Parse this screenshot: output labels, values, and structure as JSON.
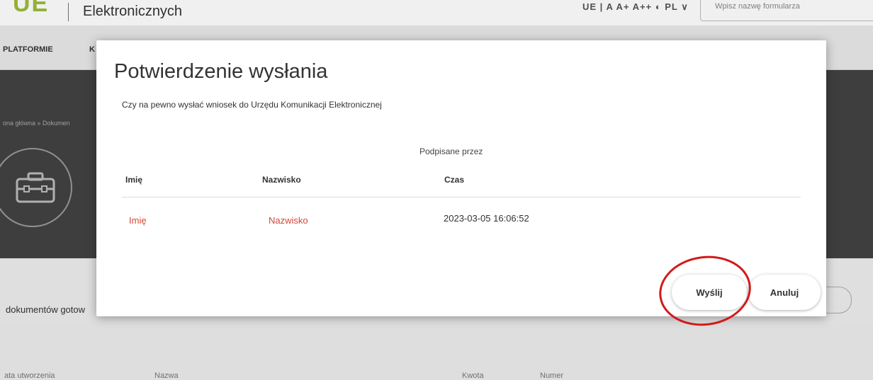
{
  "app": {
    "logo_mark": "UE",
    "logo_text": "Elektronicznych",
    "accessibility_tools": "UE | A A+ A++ ◐ PL ∨",
    "search_placeholder": "Wpisz nazwę formularza"
  },
  "nav": {
    "items": [
      "PLATFORMIE",
      "K"
    ]
  },
  "hero": {
    "breadcrumb": "ona główna » Dokumen"
  },
  "section": {
    "label": "dokumentów gotow"
  },
  "list_headers": [
    "ata utworzenia",
    "Nazwa",
    "Kwota",
    "Numer"
  ],
  "modal": {
    "title": "Potwierdzenie wysłania",
    "question": "Czy na pewno wysłać wniosek do Urzędu Komunikacji Elektronicznej",
    "signed_by_label": "Podpisane przez",
    "table": {
      "headers": [
        "Imię",
        "Nazwisko",
        "Czas"
      ],
      "rows": [
        [
          "Imię",
          "Nazwisko",
          "2023-03-05 16:06:52"
        ]
      ]
    },
    "buttons": {
      "send": "Wyślij",
      "cancel": "Anuluj"
    }
  },
  "colors": {
    "accent_red": "#d6453a",
    "annotation_circle": "#d11a1a",
    "hero_bg": "#424242"
  }
}
